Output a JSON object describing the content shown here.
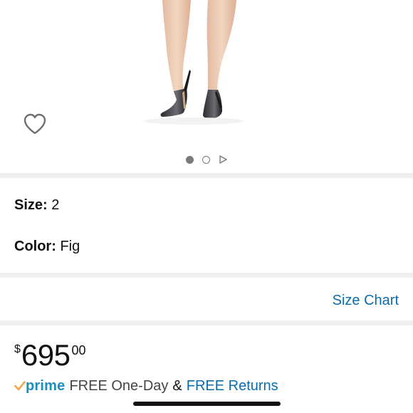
{
  "product": {
    "image_alt": "Black pointed-toe pumps shown on model"
  },
  "gallery": {
    "pages": 2,
    "active_index": 0,
    "has_video": true
  },
  "variations": {
    "size_label": "Size:",
    "size_value": "2",
    "color_label": "Color:",
    "color_value": "Fig"
  },
  "links": {
    "size_chart": "Size Chart"
  },
  "price": {
    "symbol": "$",
    "whole": "695",
    "fraction": "00"
  },
  "delivery": {
    "prime_label": "prime",
    "free_one_day": "FREE One-Day",
    "ampersand": "&",
    "free_returns": "FREE Returns"
  },
  "colors": {
    "link_blue": "#0a6cab",
    "prime_blue": "#1c8ebd",
    "prime_check_orange": "#f3a847",
    "divider_gray": "#efefef"
  },
  "icons": {
    "wishlist": "heart-outline-icon",
    "video": "play-triangle-icon",
    "prime_check": "checkmark-icon"
  }
}
